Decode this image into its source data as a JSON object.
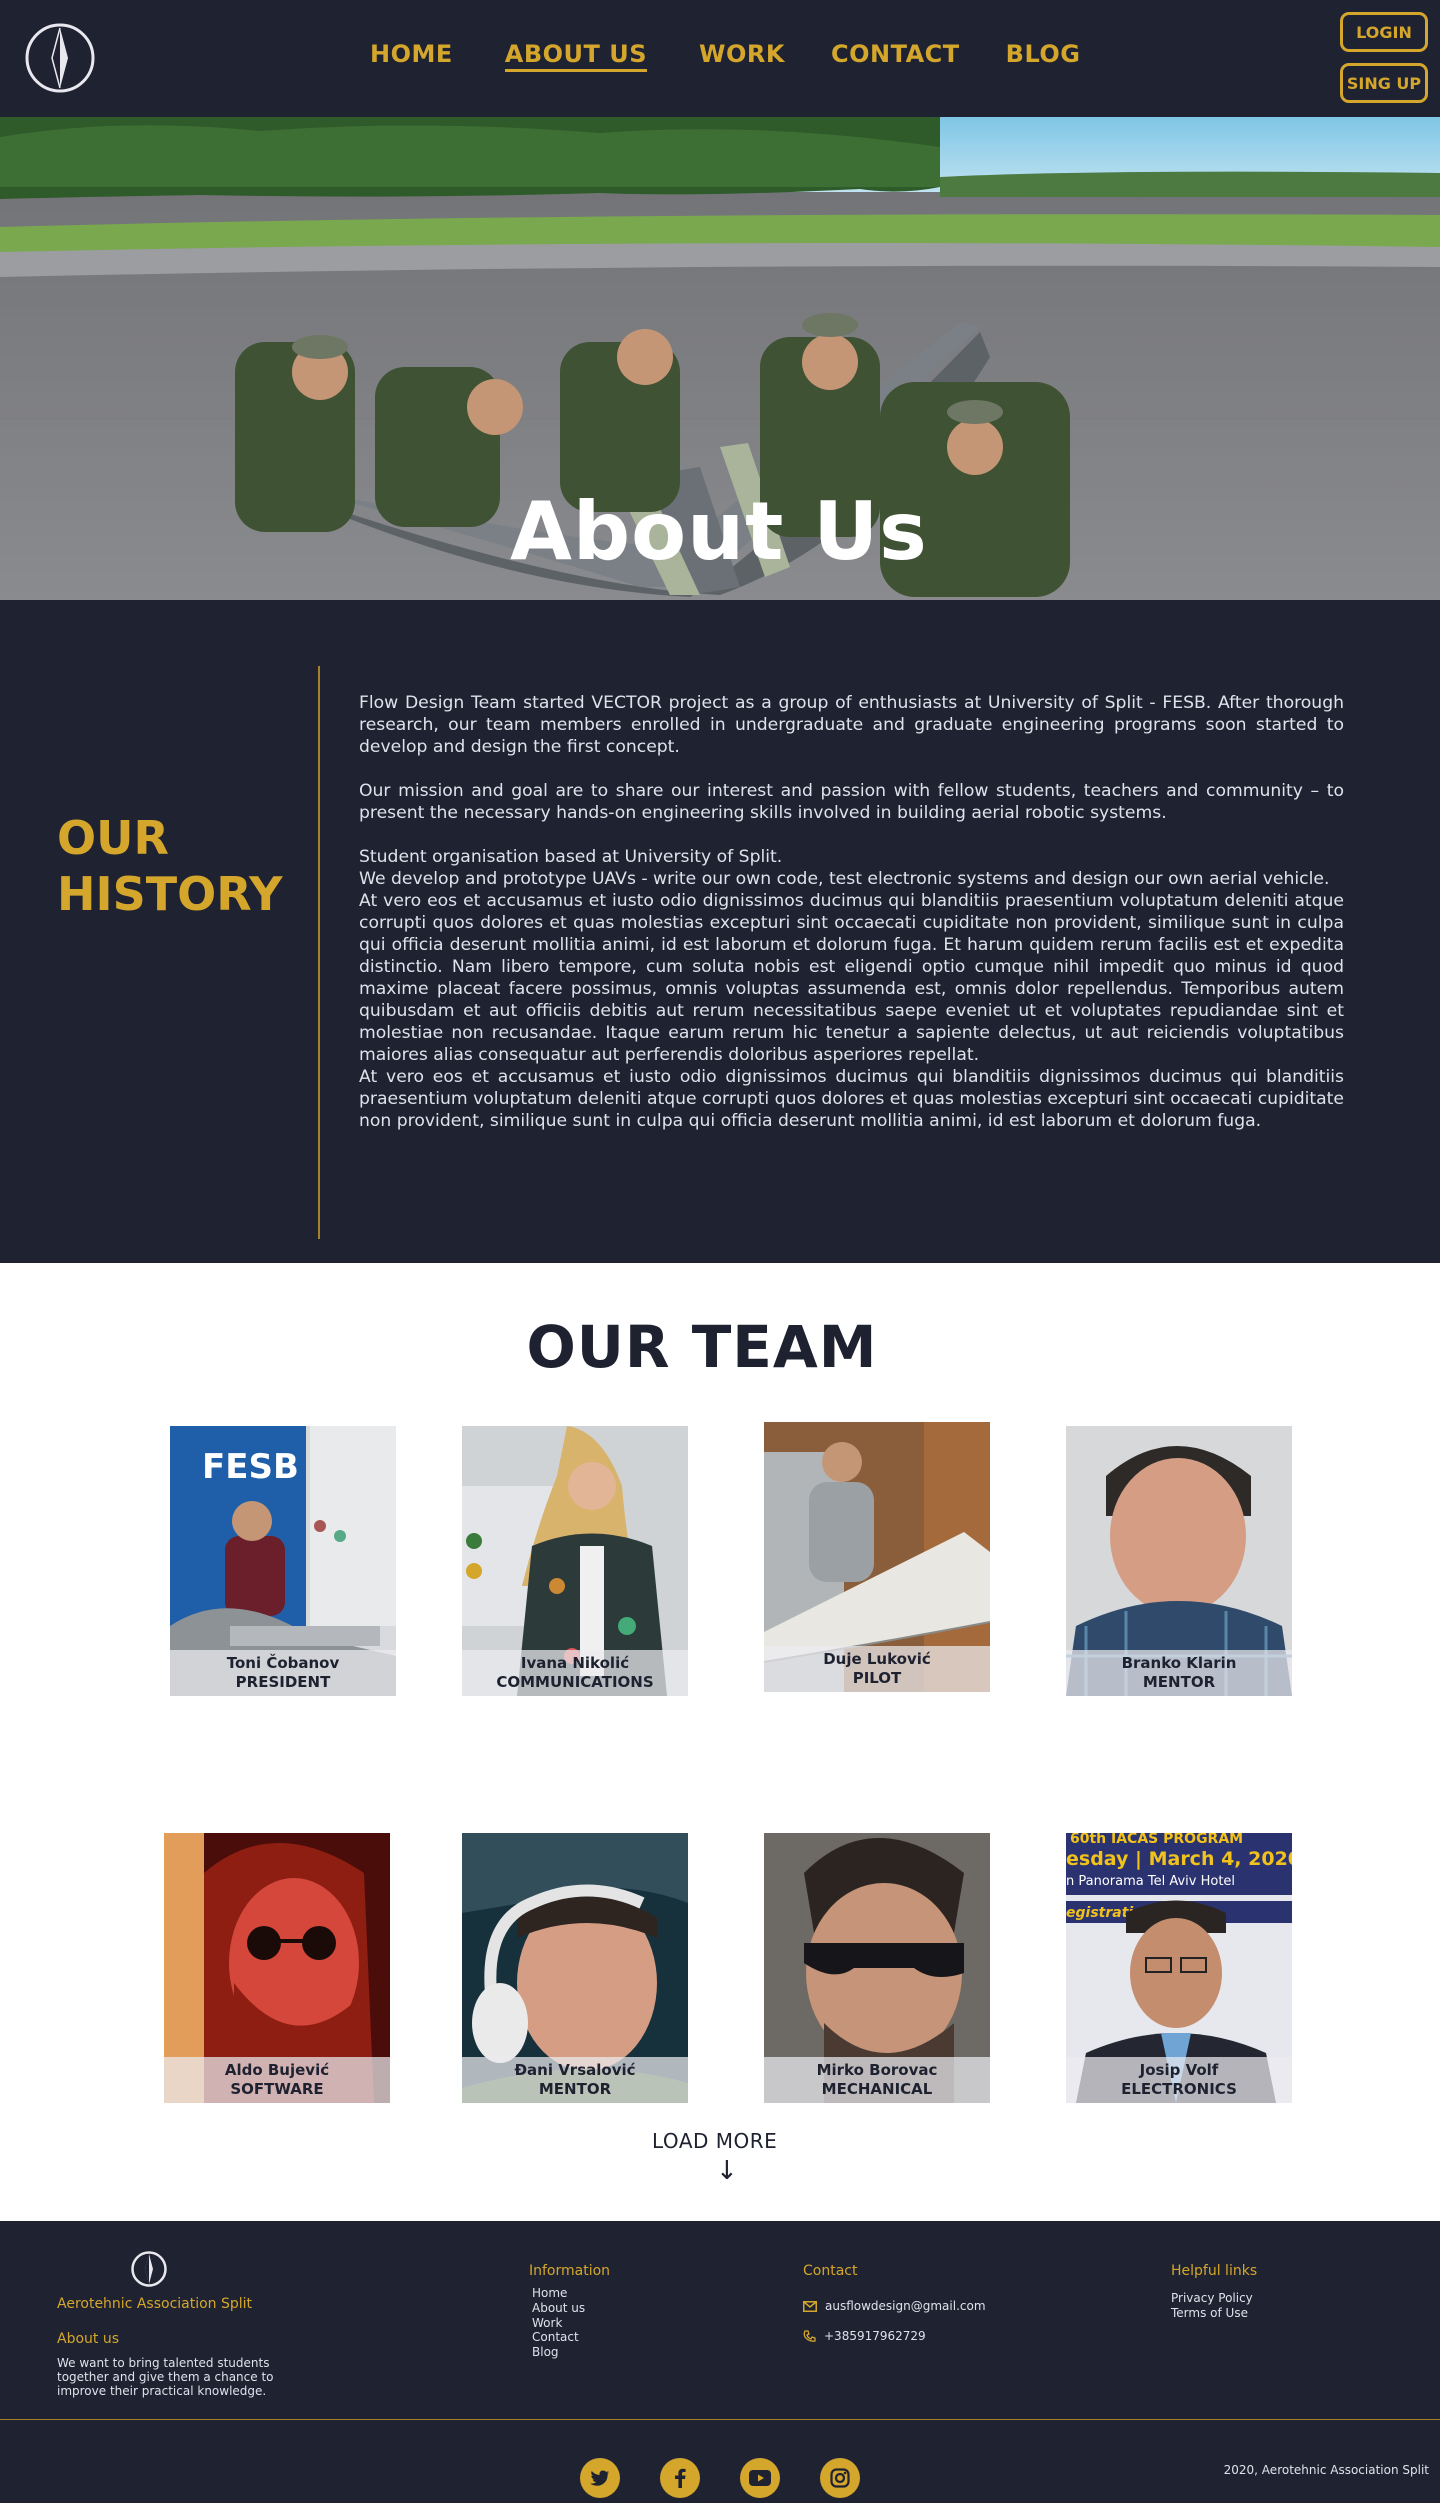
{
  "header": {
    "nav": [
      {
        "label": "HOME",
        "active": false
      },
      {
        "label": "ABOUT US",
        "active": true
      },
      {
        "label": "WORK",
        "active": false
      },
      {
        "label": "CONTACT",
        "active": false
      },
      {
        "label": "BLOG",
        "active": false
      }
    ],
    "login_label": "LOGIN",
    "signup_label": "SING UP"
  },
  "hero": {
    "title": "About Us"
  },
  "history": {
    "title_line1": "OUR",
    "title_line2": "HISTORY",
    "paragraphs": [
      "Flow Design Team started VECTOR project as a group of enthusiasts at University of Split - FESB. After thorough research, our team members enrolled in undergraduate and graduate engineering programs soon started to develop and design the first concept.",
      "Our mission and goal are to share our interest and passion with fellow students, teachers and community – to present the necessary hands-on engineering skills involved in building aerial robotic systems.",
      "Student organisation based at University of Split.",
      "We develop and prototype UAVs - write our own code, test electronic systems and design our own aerial vehicle.",
      "At vero eos et accusamus et iusto odio dignissimos ducimus qui blanditiis praesentium voluptatum deleniti atque corrupti quos dolores et quas molestias excepturi sint occaecati cupiditate non provident, similique sunt in culpa qui officia deserunt mollitia animi, id est laborum et dolorum fuga. Et harum quidem rerum facilis est et expedita distinctio. Nam libero tempore, cum soluta nobis est eligendi optio cumque nihil impedit quo minus id quod maxime placeat facere possimus, omnis voluptas assumenda est, omnis dolor repellendus. Temporibus autem quibusdam et aut officiis debitis aut rerum necessitatibus saepe eveniet ut et voluptates repudiandae sint et molestiae non recusandae. Itaque earum rerum hic tenetur a sapiente delectus, ut aut reiciendis voluptatibus maiores alias consequatur aut perferendis doloribus asperiores repellat.",
      "At vero eos et accusamus et iusto odio dignissimos ducimus qui blanditiis dignissimos ducimus qui blanditiis praesentium voluptatum deleniti atque corrupti quos dolores et quas molestias excepturi sint occaecati cupiditate non provident, similique sunt in culpa qui officia deserunt mollitia animi, id est laborum et dolorum fuga."
    ]
  },
  "team": {
    "title": "OUR TEAM",
    "members": [
      {
        "name": "Toni Čobanov",
        "role": "PRESIDENT"
      },
      {
        "name": "Ivana Nikolić",
        "role": "COMMUNICATIONS"
      },
      {
        "name": "Duje Luković",
        "role": "PILOT"
      },
      {
        "name": "Branko Klarin",
        "role": "MENTOR"
      },
      {
        "name": "Aldo Bujević",
        "role": "SOFTWARE"
      },
      {
        "name": "Đani Vrsalović",
        "role": "MENTOR"
      },
      {
        "name": "Mirko Borovac",
        "role": "MECHANICAL"
      },
      {
        "name": "Josip Volf",
        "role": "ELECTRONICS"
      }
    ],
    "photo_text": {
      "banner_brand": "FESB",
      "poster_line1": "60th IACAS PROGRAM",
      "poster_line2": "esday | March 4, 2020",
      "poster_line3": "n Panorama Tel Aviv Hotel",
      "poster_line4": "egistration"
    },
    "load_more_label": "LOAD MORE",
    "load_more_arrow": "↓"
  },
  "footer": {
    "brand": "Aerotehnic Association Split",
    "about_heading": "About us",
    "about_text": "We want to bring talented students together and give them a chance to improve their practical knowledge.",
    "information_heading": "Information",
    "information_links": [
      "Home",
      "About us",
      "Work",
      "Contact",
      "Blog"
    ],
    "contact_heading": "Contact",
    "email": "ausflowdesign@gmail.com",
    "phone": "+385917962729",
    "helpful_heading": "Helpful links",
    "helpful_links": [
      "Privacy Policy",
      "Terms of Use"
    ],
    "social": [
      "twitter-icon",
      "facebook-icon",
      "youtube-icon",
      "instagram-icon"
    ],
    "copyright": "2020, Aerotehnic Association Split"
  },
  "colors": {
    "navy": "#1f2231",
    "gold": "#d4a72c",
    "white": "#ffffff"
  }
}
